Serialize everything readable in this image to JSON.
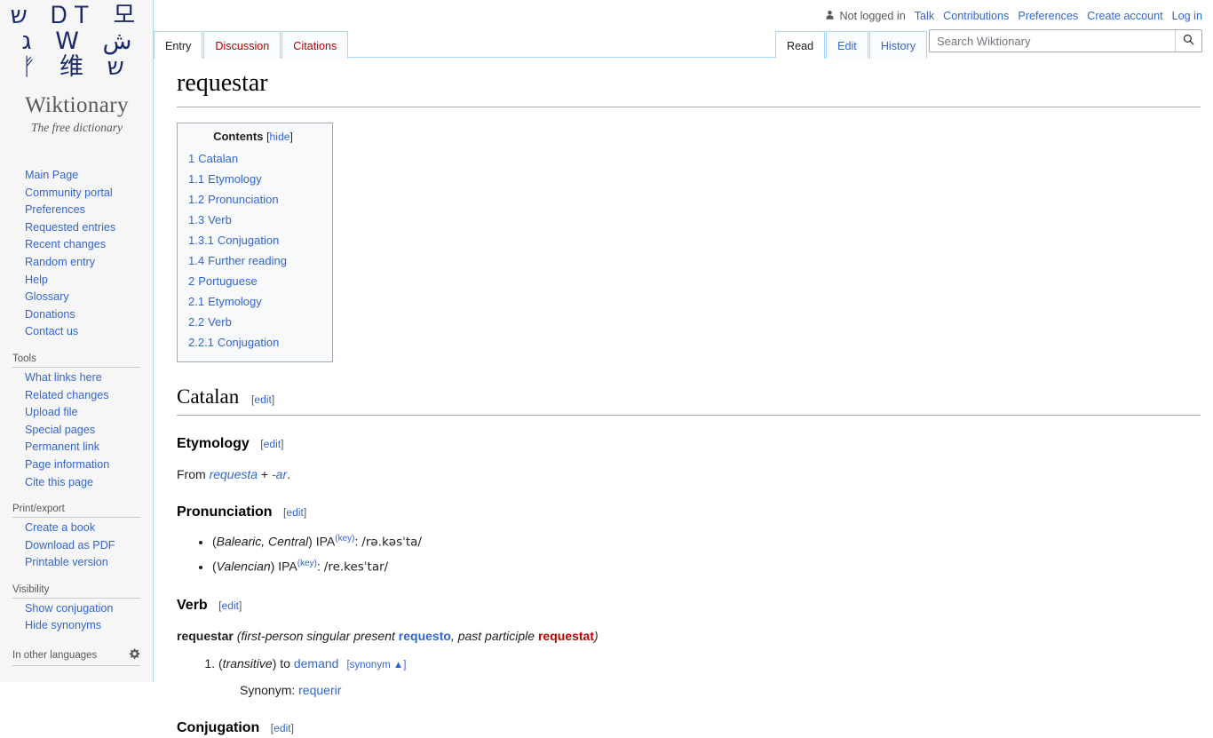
{
  "site": {
    "logo_rows": [
      {
        "chars": "ש ᎠᎢ 모"
      },
      {
        "chars": "ג W ش"
      },
      {
        "chars": "ᚠ 维 ש"
      }
    ],
    "name": "Wiktionary",
    "tagline": "The free dictionary"
  },
  "personal": {
    "user_icon": "user-silhouette-icon",
    "status": "Not logged in",
    "links": [
      "Talk",
      "Contributions",
      "Preferences",
      "Create account",
      "Log in"
    ]
  },
  "namespace_tabs": [
    {
      "label": "Entry",
      "state": "selected"
    },
    {
      "label": "Discussion",
      "state": "new"
    },
    {
      "label": "Citations",
      "state": "new"
    }
  ],
  "view_tabs": [
    {
      "label": "Read",
      "state": "selected"
    },
    {
      "label": "Edit",
      "state": "normal"
    },
    {
      "label": "History",
      "state": "normal"
    }
  ],
  "search": {
    "placeholder": "Search Wiktionary",
    "value": "",
    "icon": "search-icon"
  },
  "sidebar": {
    "navigation": {
      "items": [
        "Main Page",
        "Community portal",
        "Preferences",
        "Requested entries",
        "Recent changes",
        "Random entry",
        "Help",
        "Glossary",
        "Donations",
        "Contact us"
      ]
    },
    "tools": {
      "heading": "Tools",
      "items": [
        "What links here",
        "Related changes",
        "Upload file",
        "Special pages",
        "Permanent link",
        "Page information",
        "Cite this page"
      ]
    },
    "print": {
      "heading": "Print/export",
      "items": [
        "Create a book",
        "Download as PDF",
        "Printable version"
      ]
    },
    "visibility": {
      "heading": "Visibility",
      "items": [
        "Show conjugation",
        "Hide synonyms"
      ]
    },
    "languages": {
      "heading": "In other languages",
      "gear_icon": "gear-icon"
    }
  },
  "page": {
    "title": "requestar"
  },
  "toc": {
    "title": "Contents",
    "toggle_open": "[",
    "toggle_label": "hide",
    "toggle_close": "]",
    "entries": [
      {
        "num": "1",
        "label": "Catalan",
        "level": 1
      },
      {
        "num": "1.1",
        "label": "Etymology",
        "level": 2
      },
      {
        "num": "1.2",
        "label": "Pronunciation",
        "level": 2
      },
      {
        "num": "1.3",
        "label": "Verb",
        "level": 2
      },
      {
        "num": "1.3.1",
        "label": "Conjugation",
        "level": 3
      },
      {
        "num": "1.4",
        "label": "Further reading",
        "level": 2
      },
      {
        "num": "2",
        "label": "Portuguese",
        "level": 1
      },
      {
        "num": "2.1",
        "label": "Etymology",
        "level": 2
      },
      {
        "num": "2.2",
        "label": "Verb",
        "level": 2
      },
      {
        "num": "2.2.1",
        "label": "Conjugation",
        "level": 3
      }
    ]
  },
  "edit": {
    "open": "[",
    "label": "edit",
    "close": "]"
  },
  "catalan": {
    "heading": "Catalan",
    "etymology": {
      "heading": "Etymology",
      "prefix": "From ",
      "root": "requesta",
      "plus": " + ",
      "suffix": "-ar",
      "period": "."
    },
    "pronunciation": {
      "heading": "Pronunciation",
      "items": [
        {
          "accent": "Balearic, Central",
          "ipa_label": "IPA",
          "key": "(key)",
          "sep": ": ",
          "ipa": "/rə.kəsˈta/"
        },
        {
          "accent": "Valencian",
          "ipa_label": "IPA",
          "key": "(key)",
          "sep": ": ",
          "ipa": "/re.kesˈtar/"
        }
      ]
    },
    "verb": {
      "heading": "Verb",
      "headword": "requestar",
      "paren_open": " (",
      "form1_label": "first-person singular present ",
      "form1": "requesto",
      "comma": ", ",
      "form2_label": "past participle ",
      "form2": "requestat",
      "paren_close": ")",
      "definitions": [
        {
          "context_open": "(",
          "context": "transitive",
          "context_close": ") ",
          "text_pre": "to ",
          "link": "demand",
          "nyms_toggle": "[synonym ▲]",
          "nyms_label": "Synonym: ",
          "nyms_value": "requerir"
        }
      ]
    },
    "conjugation": {
      "heading": "Conjugation"
    }
  }
}
